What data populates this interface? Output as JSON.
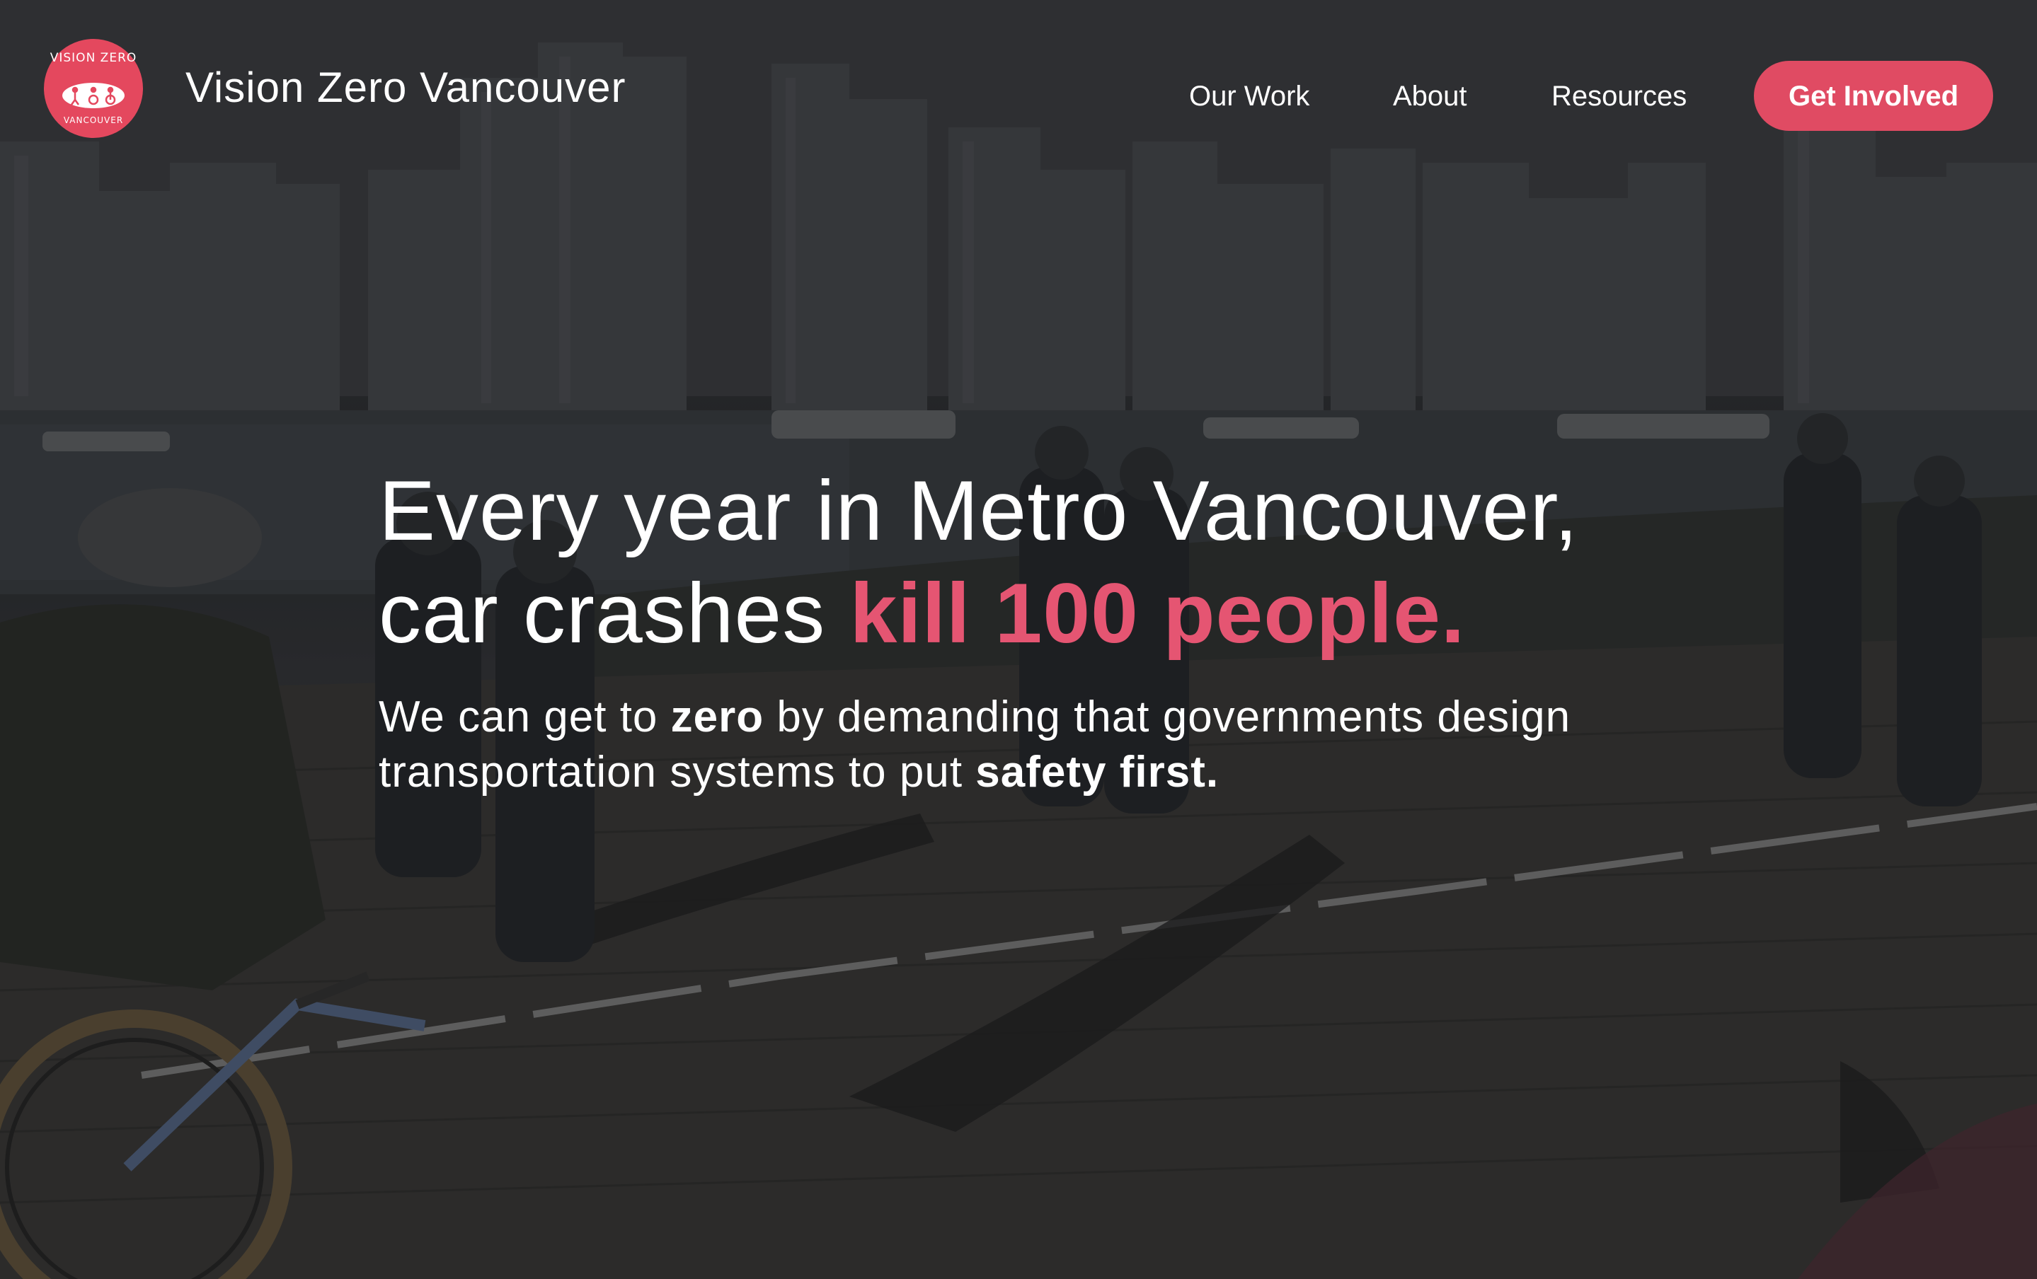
{
  "header": {
    "logo": {
      "top_text": "VISION ZERO",
      "bottom_text": "VANCOUVER",
      "color": "#e4485e"
    },
    "site_name": "Vision Zero Vancouver",
    "nav": [
      {
        "label": "Our Work"
      },
      {
        "label": "About"
      },
      {
        "label": "Resources"
      }
    ],
    "cta_label": "Get Involved",
    "cta_color": "#e04b63"
  },
  "hero": {
    "headline_line1": "Every year in Metro Vancouver,",
    "headline_line2_prefix": "car crashes ",
    "headline_line2_accent": "kill 100 people.",
    "accent_color": "#e55572",
    "sub_part1": "We can get to ",
    "sub_bold1": "zero",
    "sub_part2": " by demanding that governments design",
    "sub_part3": "transportation systems to put ",
    "sub_bold2": "safety first."
  }
}
